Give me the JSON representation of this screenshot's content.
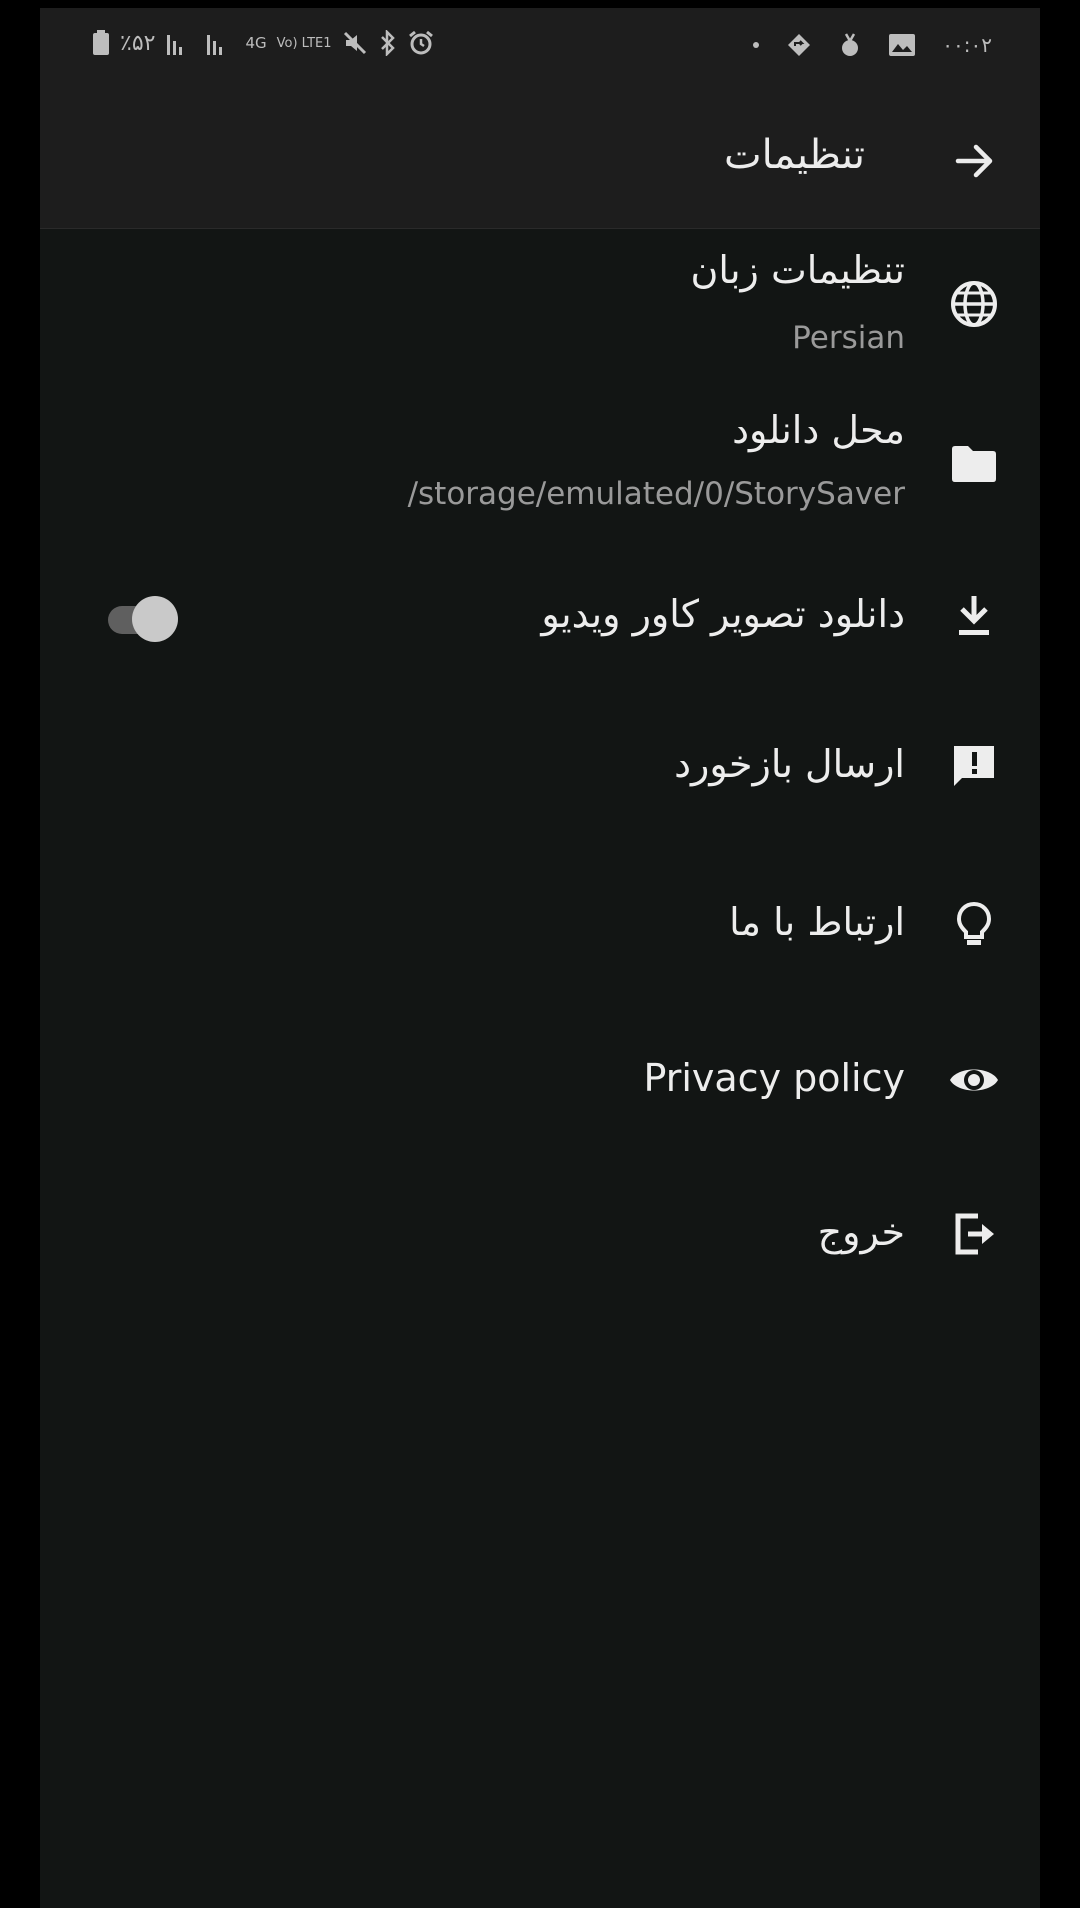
{
  "status_bar": {
    "battery": "٪۵۲",
    "network": "4G",
    "volte": "Vo) LTE1",
    "time": "۰۰:۰۲"
  },
  "app_bar": {
    "title": "تنظیمات"
  },
  "settings": {
    "language": {
      "title": "تنظیمات زبان",
      "value": "Persian"
    },
    "download_location": {
      "title": "محل دانلود",
      "value": "/storage/emulated/0/StorySaver"
    },
    "video_cover": {
      "title": "دانلود تصویر کاور ویدیو",
      "toggle_on": true
    },
    "feedback": {
      "title": "ارسال بازخورد"
    },
    "contact": {
      "title": "ارتباط با ما"
    },
    "privacy": {
      "title": "Privacy policy"
    },
    "logout": {
      "title": "خروج"
    }
  },
  "colors": {
    "background": "#121514",
    "appbar": "#1d1d1d",
    "text_primary": "#ededed",
    "text_secondary": "#9a9a9a",
    "toggle_track": "#5f5f5f",
    "toggle_thumb": "#c9c9c9"
  },
  "icons": {
    "back": "arrow-right-icon",
    "language": "globe-icon",
    "download_location": "folder-icon",
    "video_cover": "download-icon",
    "feedback": "feedback-icon",
    "contact": "lightbulb-icon",
    "privacy": "eye-icon",
    "logout": "logout-icon"
  }
}
